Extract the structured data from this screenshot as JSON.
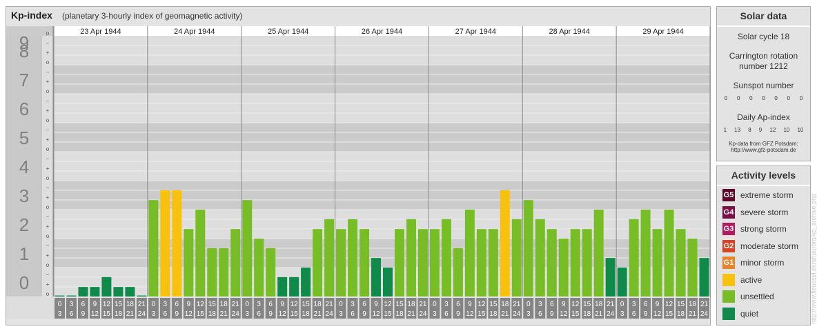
{
  "header": {
    "title": "Kp-index",
    "subtitle": "(planetary 3-hourly index of geomagnetic activity)"
  },
  "solar": {
    "heading": "Solar data",
    "cycle": "Solar cycle 18",
    "carrington_line1": "Carrington rotation",
    "carrington_line2": "number 1212",
    "sunspot_label": "Sunspot number",
    "sunspot_values": [
      "0",
      "0",
      "0",
      "0",
      "0",
      "0",
      "0"
    ],
    "ap_label": "Daily Ap-index",
    "ap_values": [
      "1",
      "13",
      "8",
      "9",
      "12",
      "10",
      "10"
    ],
    "source_line1": "Kp-data from GFZ Potsdam:",
    "source_line2": "http://www.gfz-potsdam.de"
  },
  "levels": {
    "heading": "Activity levels",
    "items": [
      {
        "code": "G5",
        "label": "extreme storm",
        "color": "#5c0a2a"
      },
      {
        "code": "G4",
        "label": "severe storm",
        "color": "#7d0e45"
      },
      {
        "code": "G3",
        "label": "strong storm",
        "color": "#b3195d"
      },
      {
        "code": "G2",
        "label": "moderate storm",
        "color": "#d94326"
      },
      {
        "code": "G1",
        "label": "minor storm",
        "color": "#e8852a"
      },
      {
        "code": "",
        "label": "active",
        "color": "#f8c20c"
      },
      {
        "code": "",
        "label": "unsettled",
        "color": "#77bd25"
      },
      {
        "code": "",
        "label": "quiet",
        "color": "#0f8a4a"
      }
    ]
  },
  "credit": "http://www.fleussel.ekraf/aurora/kp_archive.php",
  "chart_data": {
    "type": "bar",
    "ylim": [
      0,
      9
    ],
    "y_major_ticks": [
      "0",
      "1",
      "2",
      "3",
      "4",
      "5",
      "6",
      "7",
      "8",
      "9"
    ],
    "y_minor_ticks": [
      "o",
      "+",
      "−"
    ],
    "days": [
      "23 Apr 1944",
      "24 Apr 1944",
      "25 Apr 1944",
      "26 Apr 1944",
      "27 Apr 1944",
      "28 Apr 1944",
      "29 Apr 1944"
    ],
    "interval_start": [
      "0",
      "3",
      "6",
      "9",
      "12",
      "15",
      "18",
      "21"
    ],
    "interval_end": [
      "3",
      "6",
      "9",
      "12",
      "15",
      "18",
      "21",
      "24"
    ],
    "values": [
      0.0,
      0.0,
      0.33,
      0.33,
      0.67,
      0.33,
      0.33,
      0.0,
      3.33,
      3.67,
      3.67,
      2.33,
      3.0,
      1.67,
      1.67,
      2.33,
      3.33,
      2.0,
      1.67,
      0.67,
      0.67,
      1.0,
      2.33,
      2.67,
      2.33,
      2.67,
      2.33,
      1.33,
      1.0,
      2.33,
      2.67,
      2.33,
      2.33,
      2.67,
      1.67,
      3.0,
      2.33,
      2.33,
      3.67,
      2.67,
      3.33,
      2.67,
      2.33,
      2.0,
      2.33,
      2.33,
      3.0,
      1.33,
      1.0,
      2.67,
      3.0,
      2.33,
      3.0,
      2.33,
      2.0,
      1.33
    ],
    "colors": {
      "quiet": "#0f8a4a",
      "unsettled": "#77bd25",
      "active": "#f8c20c",
      "band_dark": "#cbcbcb",
      "band_light": "#dedede",
      "label_bg": "#c9c9c9",
      "label_fg": "#808080",
      "tick_box": "#858585"
    }
  }
}
